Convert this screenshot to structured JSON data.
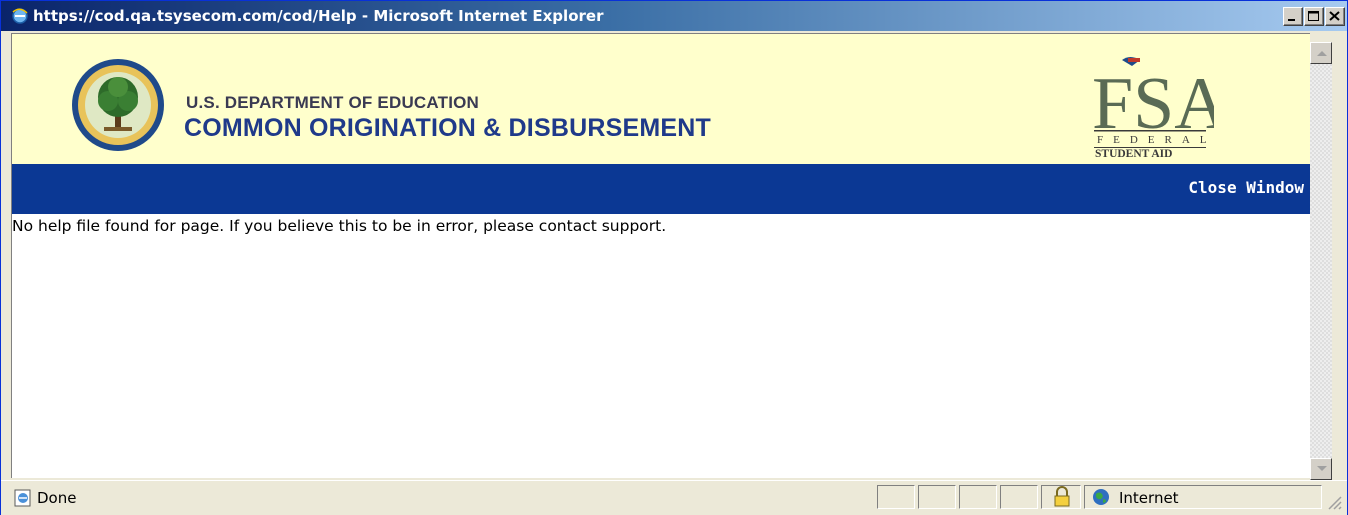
{
  "window": {
    "title": "https://cod.qa.tsysecom.com/cod/Help - Microsoft Internet Explorer"
  },
  "banner": {
    "agency": "U.S. DEPARTMENT OF EDUCATION",
    "system": "COMMON ORIGINATION & DISBURSEMENT",
    "logo_letters": "FSA",
    "logo_line1": "FEDERAL",
    "logo_line2": "STUDENT AID"
  },
  "toolbar": {
    "close_label": "Close Window"
  },
  "content": {
    "message": "No help file found for page. If you believe this to be in error, please contact support."
  },
  "status": {
    "text": "Done",
    "zone": "Internet"
  },
  "colors": {
    "banner_bg": "#ffffcc",
    "bar_bg": "#0b3894",
    "title_gradient_start": "#0a246a"
  },
  "icons": [
    "ie-icon",
    "minimize-icon",
    "maximize-icon",
    "close-icon",
    "seal-icon",
    "fsa-logo",
    "scroll-up-icon",
    "scroll-down-icon",
    "lock-icon",
    "globe-icon",
    "resize-grip-icon"
  ]
}
